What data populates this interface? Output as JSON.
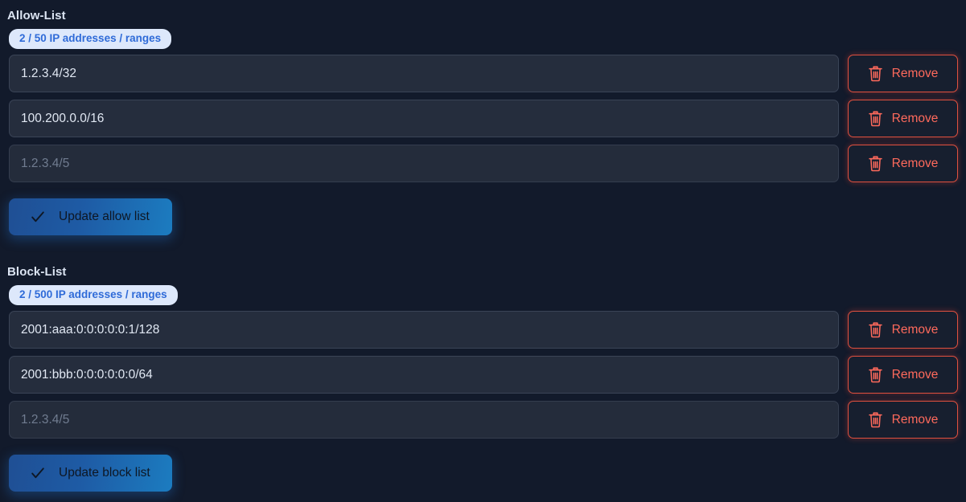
{
  "page": {
    "background_color": "#121a2b",
    "accent_blue": "#1c7cc0",
    "danger_red": "#ff6a5c",
    "badge_bg": "#dde8fb",
    "badge_text": "#2f6bd8"
  },
  "sections": [
    {
      "id": "allow",
      "title": "Allow-List",
      "badge": "2 / 50 IP addresses / ranges",
      "rows": [
        {
          "value": "1.2.3.4/32",
          "placeholder": "1.2.3.4/5",
          "is_empty": false,
          "remove_label": "Remove"
        },
        {
          "value": "100.200.0.0/16",
          "placeholder": "1.2.3.4/5",
          "is_empty": false,
          "remove_label": "Remove"
        },
        {
          "value": "",
          "placeholder": "1.2.3.4/5",
          "is_empty": true,
          "remove_label": "Remove"
        }
      ],
      "update_label": "Update allow list"
    },
    {
      "id": "block",
      "title": "Block-List",
      "badge": "2 / 500 IP addresses / ranges",
      "rows": [
        {
          "value": "2001:aaa:0:0:0:0:0:1/128",
          "placeholder": "1.2.3.4/5",
          "is_empty": false,
          "remove_label": "Remove"
        },
        {
          "value": "2001:bbb:0:0:0:0:0:0/64",
          "placeholder": "1.2.3.4/5",
          "is_empty": false,
          "remove_label": "Remove"
        },
        {
          "value": "",
          "placeholder": "1.2.3.4/5",
          "is_empty": true,
          "remove_label": "Remove"
        }
      ],
      "update_label": "Update block list"
    }
  ],
  "icons": {
    "remove": "trash-icon",
    "update": "check-icon"
  }
}
